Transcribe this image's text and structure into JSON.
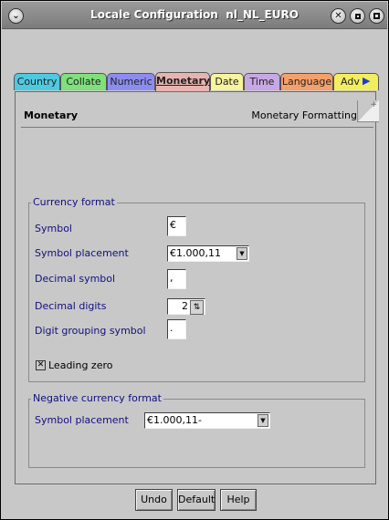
{
  "window": {
    "title": "Locale Configuration  nl_NL_EURO",
    "menu_icon": "chevron-down",
    "close_icon": "close",
    "min_icon": "minimize",
    "max_icon": "maximize"
  },
  "tabs": [
    {
      "label": "Country",
      "color": "#4fc9e0"
    },
    {
      "label": "Collate",
      "color": "#7fe07c"
    },
    {
      "label": "Numeric",
      "color": "#8c8cf0"
    },
    {
      "label": "Monetary",
      "color": "#e8b4b0",
      "active": true
    },
    {
      "label": "Date",
      "color": "#f6f49c"
    },
    {
      "label": "Time",
      "color": "#c8a8e4"
    },
    {
      "label": "Language",
      "color": "#f4a06a"
    },
    {
      "label": "Adv",
      "color": "#f2ee60"
    }
  ],
  "tab_scroll_icon": "triangle-right",
  "panel": {
    "title": "Monetary",
    "subtitle": "Monetary Formatting"
  },
  "currency_format": {
    "legend": "Currency format",
    "symbol_label": "Symbol",
    "symbol_value": "€",
    "placement_label": "Symbol placement",
    "placement_value": "€1.000,11",
    "decimal_symbol_label": "Decimal symbol",
    "decimal_symbol_value": ",",
    "decimal_digits_label": "Decimal digits",
    "decimal_digits_value": "2",
    "grouping_label": "Digit grouping symbol",
    "grouping_value": ".",
    "leading_zero_label": "Leading zero",
    "leading_zero_checked": true
  },
  "negative_format": {
    "legend": "Negative currency format",
    "placement_label": "Symbol placement",
    "placement_value": "€1.000,11-"
  },
  "buttons": {
    "undo": "Undo",
    "default": "Default",
    "help": "Help"
  }
}
